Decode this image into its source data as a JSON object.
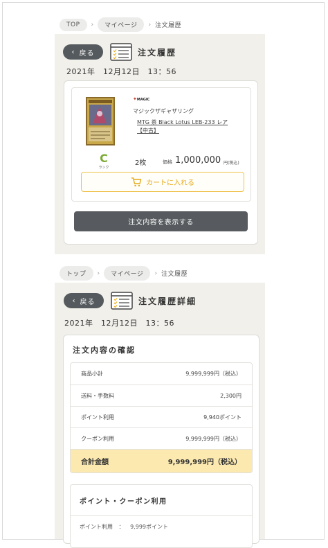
{
  "top": {
    "breadcrumb": {
      "items": [
        "TOP",
        "マイページ"
      ],
      "current": "注文履歴"
    },
    "back_label": "戻る",
    "title": "注文履歴",
    "date": "2021年　12月12日　13：56",
    "order": {
      "brand": "MAGIC",
      "shop": "マジックザギャザリング",
      "item_line1": "MTG 茶 Black Lotus LEB-233 レア",
      "item_line2": "【中古】",
      "rank": "C",
      "rank_caption": "ランク",
      "qty": "2枚",
      "price_label": "価格",
      "price": "1,000,000",
      "price_suffix": "円(税込)",
      "cart_label": "カートに入れる",
      "show_label": "注文内容を表示する"
    }
  },
  "bottom": {
    "breadcrumb": {
      "items": [
        "トップ",
        "マイページ"
      ],
      "current": "注文履歴"
    },
    "back_label": "戻る",
    "title": "注文履歴詳細",
    "date": "2021年　12月12日　13：56",
    "confirm_title": "注文内容の確認",
    "rows": [
      {
        "label": "商品小計",
        "value": "9,999,999円（税込）"
      },
      {
        "label": "送料・手数料",
        "value": "2,300円"
      },
      {
        "label": "ポイント利用",
        "value": "9,940ポイント"
      },
      {
        "label": "クーポン利用",
        "value": "9,999,999円（税込）"
      }
    ],
    "total": {
      "label": "合計金額",
      "value": "9,999,999円（税込）"
    },
    "points_title": "ポイント・クーポン利用",
    "points_row": {
      "label": "ポイント利用",
      "sep": "：",
      "value": "9,999ポイント"
    }
  },
  "colors": {
    "accent": "#f0c14b",
    "rank": "#7cab34",
    "total_bg": "#fbe9b0",
    "dark_button": "#575b5f"
  }
}
